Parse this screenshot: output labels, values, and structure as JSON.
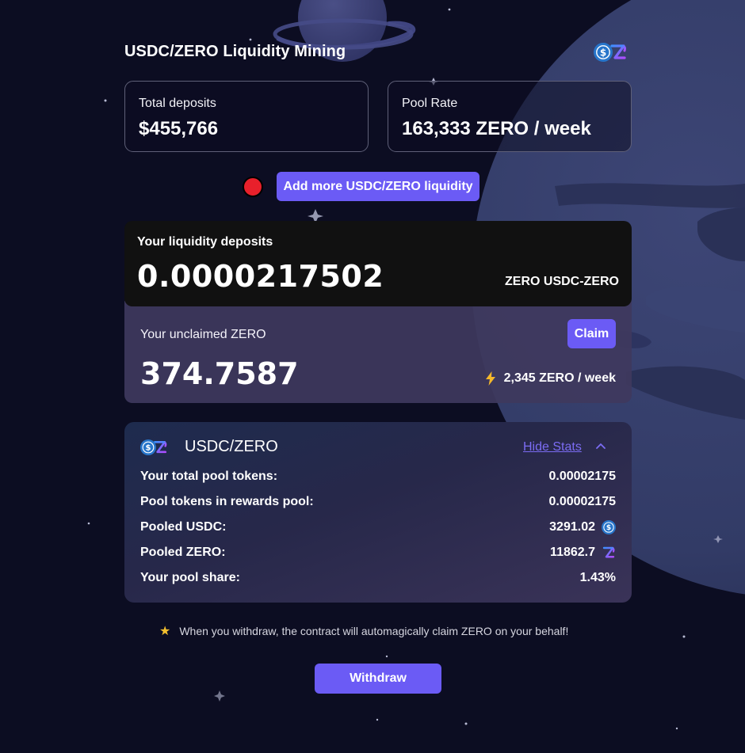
{
  "page": {
    "title": "USDC/ZERO Liquidity Mining",
    "logo_icons": [
      "usdc-icon",
      "zero-icon"
    ]
  },
  "stats": {
    "total_deposits_label": "Total deposits",
    "total_deposits_value": "$455,766",
    "pool_rate_label": "Pool Rate",
    "pool_rate_value": "163,333 ZERO / week"
  },
  "actions": {
    "add_liquidity_label": "Add more USDC/ZERO liquidity",
    "claim_label": "Claim",
    "withdraw_label": "Withdraw"
  },
  "deposits": {
    "label": "Your liquidity deposits",
    "value": "0.0000217502",
    "unit": "ZERO USDC-ZERO"
  },
  "unclaimed": {
    "label": "Your unclaimed ZERO",
    "value": "374.7587",
    "rate": "2,345 ZERO / week",
    "rate_icon": "lightning-icon"
  },
  "pool_stats": {
    "pair_name": "USDC/ZERO",
    "hide_stats_label": "Hide Stats",
    "rows": [
      {
        "label": "Your total pool tokens:",
        "value": "0.00002175"
      },
      {
        "label": "Pool tokens in rewards pool:",
        "value": "0.00002175"
      },
      {
        "label": "Pooled USDC:",
        "value": "3291.02",
        "icon": "usdc-icon"
      },
      {
        "label": "Pooled ZERO:",
        "value": "11862.7",
        "icon": "zero-icon"
      },
      {
        "label": "Your pool share:",
        "value": "1.43%"
      }
    ]
  },
  "note": {
    "icon": "star-icon",
    "text": "When you withdraw, the contract will automagically claim ZERO on your behalf!"
  },
  "colors": {
    "background": "#0c0d22",
    "accent": "#6b5bf5",
    "link": "#7b6cf3",
    "alert_dot": "#e8202b",
    "deposits_card": "#111111",
    "unclaimed_card": "#3e395e",
    "usdc_blue": "#2775ca",
    "zero_gradient_start": "#3e8fff",
    "zero_gradient_end": "#b04bff"
  }
}
